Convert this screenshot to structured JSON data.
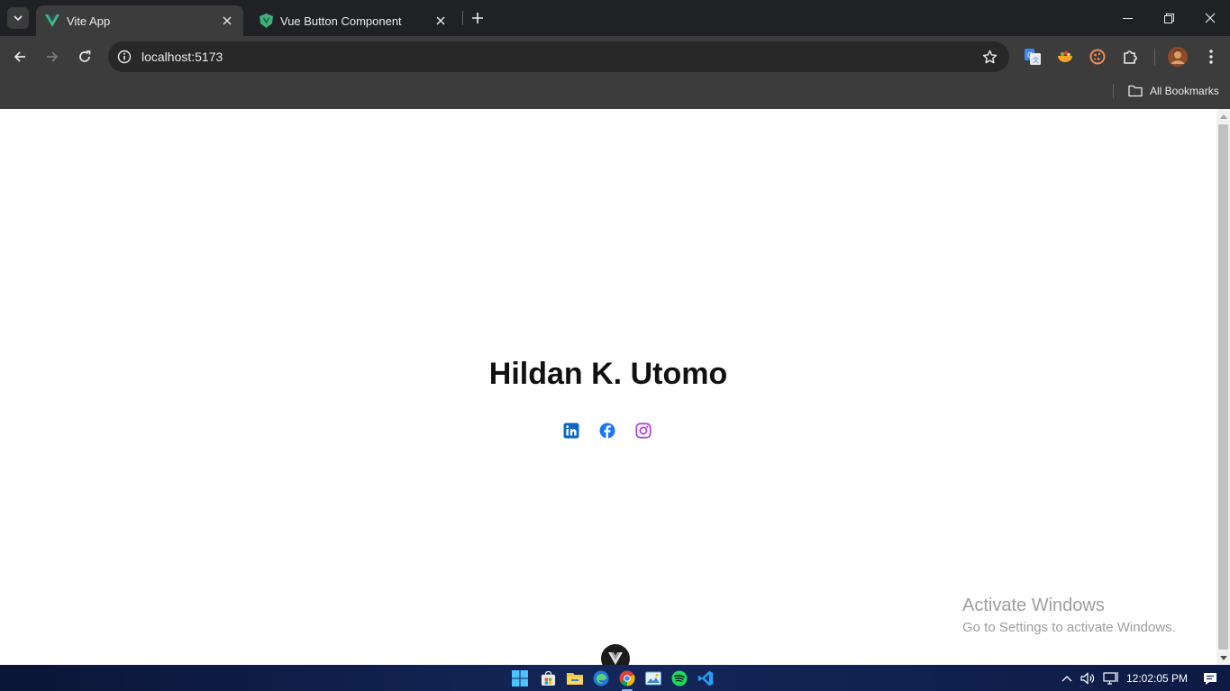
{
  "browser": {
    "tabs": [
      {
        "label": "Vite App",
        "active": true
      },
      {
        "label": "Vue Button Component",
        "active": false
      }
    ],
    "url": "localhost:5173",
    "bookmarks_label": "All Bookmarks"
  },
  "page": {
    "heading": "Hildan K. Utomo",
    "social_links": [
      {
        "icon": "linkedin-icon",
        "color": "#0a66c2"
      },
      {
        "icon": "facebook-icon",
        "color": "#1877f2"
      },
      {
        "icon": "instagram-icon",
        "color": "#b144e0"
      }
    ]
  },
  "watermark": {
    "title": "Activate Windows",
    "subtitle": "Go to Settings to activate Windows."
  },
  "taskbar": {
    "apps": [
      "start-icon",
      "store-icon",
      "file-explorer-icon",
      "edge-icon",
      "chrome-icon",
      "photos-icon",
      "spotify-icon",
      "vscode-icon"
    ],
    "clock": "12:02:05 PM"
  },
  "colors": {
    "tab_strip": "#202124",
    "toolbar": "#3c3c3c",
    "vue_green": "#41b883",
    "taskbar": "#14275a"
  }
}
